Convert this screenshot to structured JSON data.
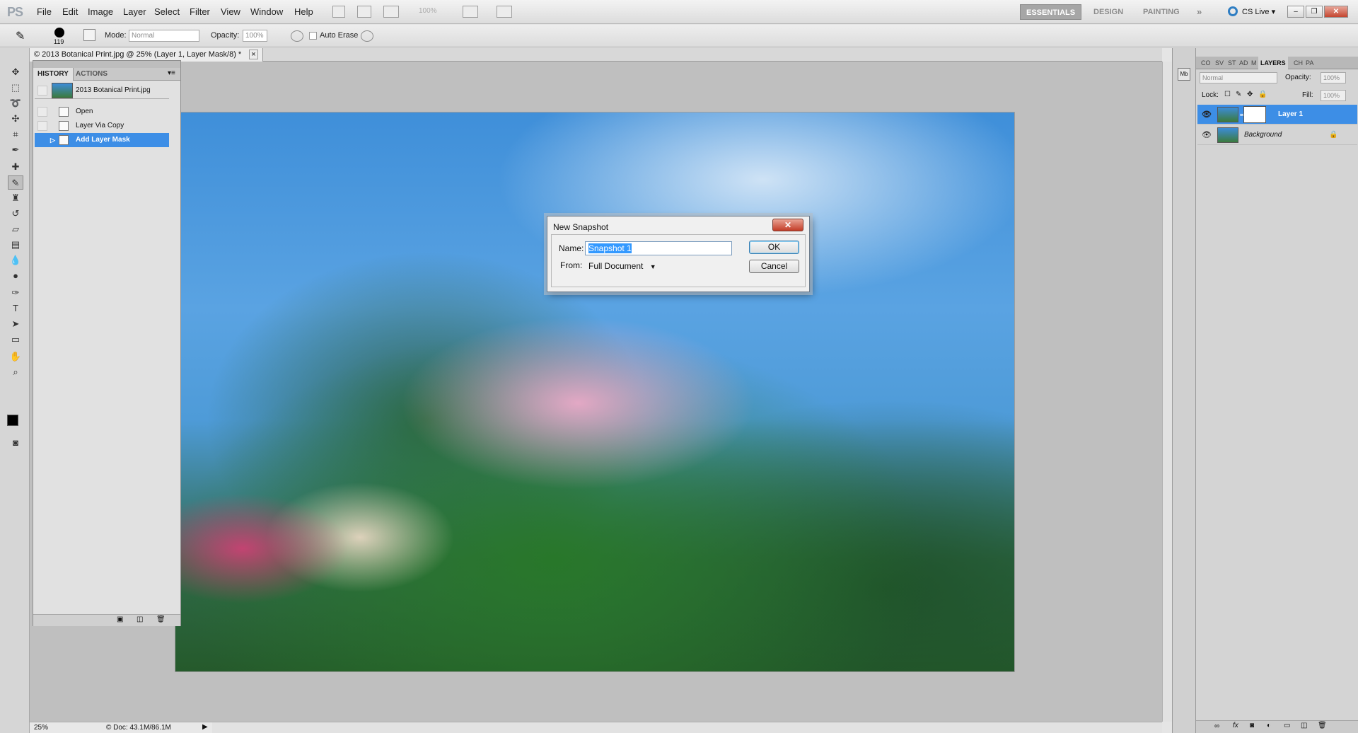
{
  "app": {
    "logo": "PS"
  },
  "menu": [
    "File",
    "Edit",
    "Image",
    "Layer",
    "Select",
    "Filter",
    "View",
    "Window",
    "Help"
  ],
  "zoom_box": "100%",
  "workspaces": {
    "essentials": "ESSENTIALS",
    "design": "DESIGN",
    "painting": "PAINTING",
    "more": "»",
    "cs_live": "CS Live ▾"
  },
  "options": {
    "brush_size": "119",
    "mode_label": "Mode:",
    "mode_value": "Normal",
    "opacity_label": "Opacity:",
    "opacity_value": "100%",
    "auto_erase": "Auto Erase"
  },
  "document": {
    "tab_title": "© 2013 Botanical Print.jpg @ 25% (Layer 1, Layer Mask/8) *",
    "tab_close": "×",
    "zoom": "25%",
    "doc_size": "© Doc: 43.1M/86.1M"
  },
  "history": {
    "tabs": [
      "HISTORY",
      "ACTIONS"
    ],
    "snapshot": "2013 Botanical Print.jpg",
    "items": [
      {
        "label": "Open"
      },
      {
        "label": "Layer Via Copy"
      },
      {
        "label": "Add Layer Mask"
      }
    ]
  },
  "layers": {
    "tabs": [
      "CO",
      "SV",
      "ST",
      "AD",
      "M",
      "LAYERS",
      "CH",
      "PA"
    ],
    "blend_mode": "Normal",
    "opacity_label": "Opacity:",
    "opacity_value": "100%",
    "lock_label": "Lock:",
    "fill_label": "Fill:",
    "fill_value": "100%",
    "items": [
      {
        "name": "Layer 1"
      },
      {
        "name": "Background"
      }
    ]
  },
  "dialog": {
    "title": "New Snapshot",
    "name_label": "Name:",
    "name_value": "Snapshot 1",
    "from_label": "From:",
    "from_value": "Full Document",
    "ok": "OK",
    "cancel": "Cancel",
    "close": "✕"
  }
}
